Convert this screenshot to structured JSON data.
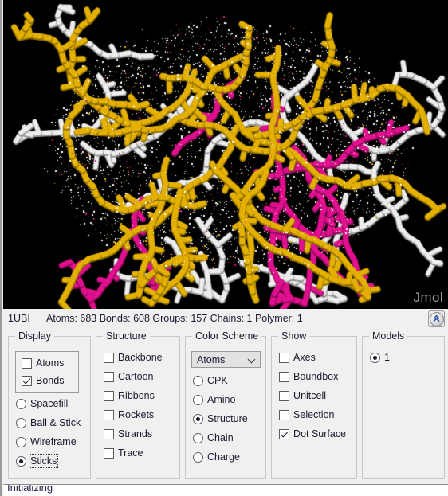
{
  "viewer": {
    "watermark": "Jmol",
    "background_color": "#000000",
    "structure_colors": {
      "helix": "#E5B100",
      "sheet": "#E2108F",
      "turn_coil": "#EDEDED",
      "dot_surface": "#FFFFFF"
    }
  },
  "status": {
    "pdb_id": "1UBI",
    "counts": "Atoms: 683  Bonds: 608  Groups: 157  Chains: 1  Polymer: 1",
    "atoms_label": "Atoms: 683",
    "bonds_label": "Bonds: 608",
    "groups_label": "Groups: 157",
    "chains_label": "Chains: 1",
    "polymer_label": "Polymer: 1",
    "collapse_icon": "double-chevron-up-icon"
  },
  "panels": {
    "display": {
      "title": "Display",
      "subgroup": [
        {
          "label": "Atoms",
          "checked": false
        },
        {
          "label": "Bonds",
          "checked": true
        }
      ],
      "options": [
        {
          "label": "Spacefill",
          "selected": false,
          "focused": false
        },
        {
          "label": "Ball & Stick",
          "selected": false,
          "focused": false
        },
        {
          "label": "Wireframe",
          "selected": false,
          "focused": false
        },
        {
          "label": "Sticks",
          "selected": true,
          "focused": true
        }
      ]
    },
    "structure": {
      "title": "Structure",
      "options": [
        {
          "label": "Backbone",
          "checked": false
        },
        {
          "label": "Cartoon",
          "checked": false
        },
        {
          "label": "Ribbons",
          "checked": false
        },
        {
          "label": "Rockets",
          "checked": false
        },
        {
          "label": "Strands",
          "checked": false
        },
        {
          "label": "Trace",
          "checked": false
        }
      ]
    },
    "color_scheme": {
      "title": "Color Scheme",
      "dropdown_value": "Atoms",
      "dropdown_icon": "chevron-down-icon",
      "options": [
        {
          "label": "CPK",
          "selected": false
        },
        {
          "label": "Amino",
          "selected": false
        },
        {
          "label": "Structure",
          "selected": true
        },
        {
          "label": "Chain",
          "selected": false
        },
        {
          "label": "Charge",
          "selected": false
        }
      ]
    },
    "show": {
      "title": "Show",
      "options": [
        {
          "label": "Axes",
          "checked": false
        },
        {
          "label": "Boundbox",
          "checked": false
        },
        {
          "label": "Unitcell",
          "checked": false
        },
        {
          "label": "Selection",
          "checked": false
        },
        {
          "label": "Dot Surface",
          "checked": true
        }
      ]
    },
    "models": {
      "title": "Models",
      "options": [
        {
          "label": "1",
          "selected": true
        }
      ]
    }
  },
  "console": {
    "message": "Initializing"
  }
}
